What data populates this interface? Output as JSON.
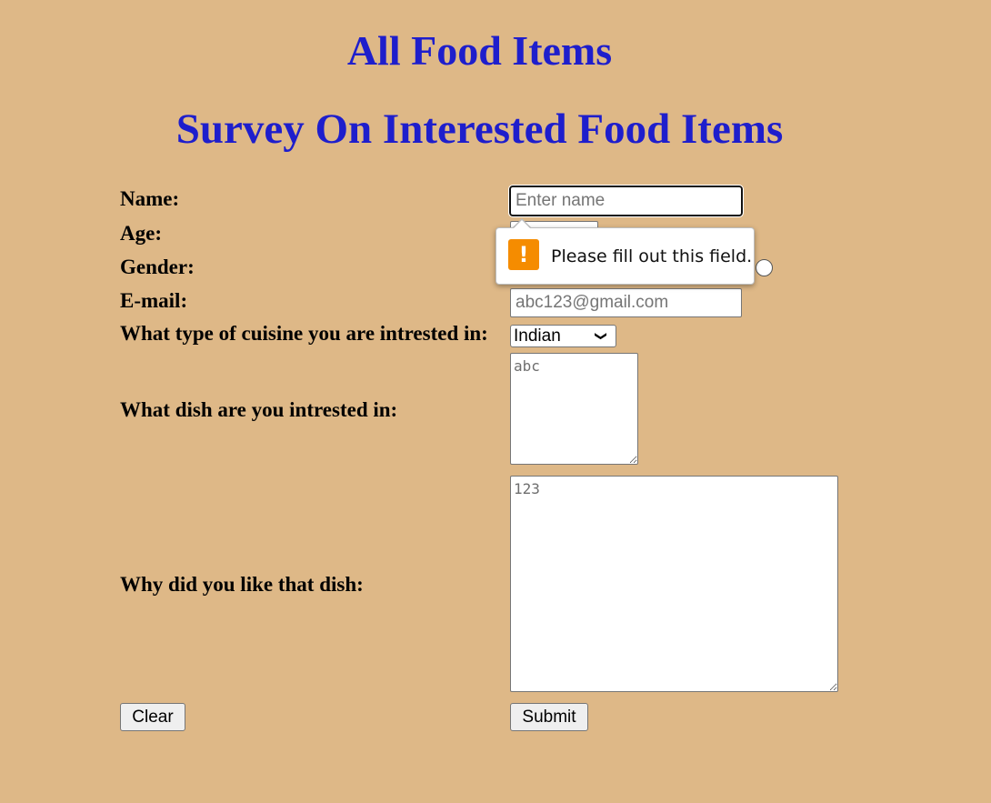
{
  "page": {
    "title": "All Food Items",
    "subtitle": "Survey On Interested Food Items"
  },
  "form": {
    "name_label": "Name:",
    "name_placeholder": "Enter name",
    "age_label": "Age:",
    "gender_label": "Gender:",
    "email_label": "E-mail:",
    "email_placeholder": "abc123@gmail.com",
    "cuisine_label": "What type of cuisine you are intrested in:",
    "cuisine_selected": "Indian",
    "dish_label": "What dish are you intrested in:",
    "dish_placeholder": "abc",
    "why_label": "Why did you like that dish:",
    "why_placeholder": "123",
    "clear_label": "Clear",
    "submit_label": "Submit"
  },
  "validation": {
    "message": "Please fill out this field.",
    "icon": "warning-icon",
    "icon_glyph": "!",
    "icon_color": "#f58c00"
  },
  "colors": {
    "background": "#deb887",
    "heading": "#1e1ecc"
  }
}
